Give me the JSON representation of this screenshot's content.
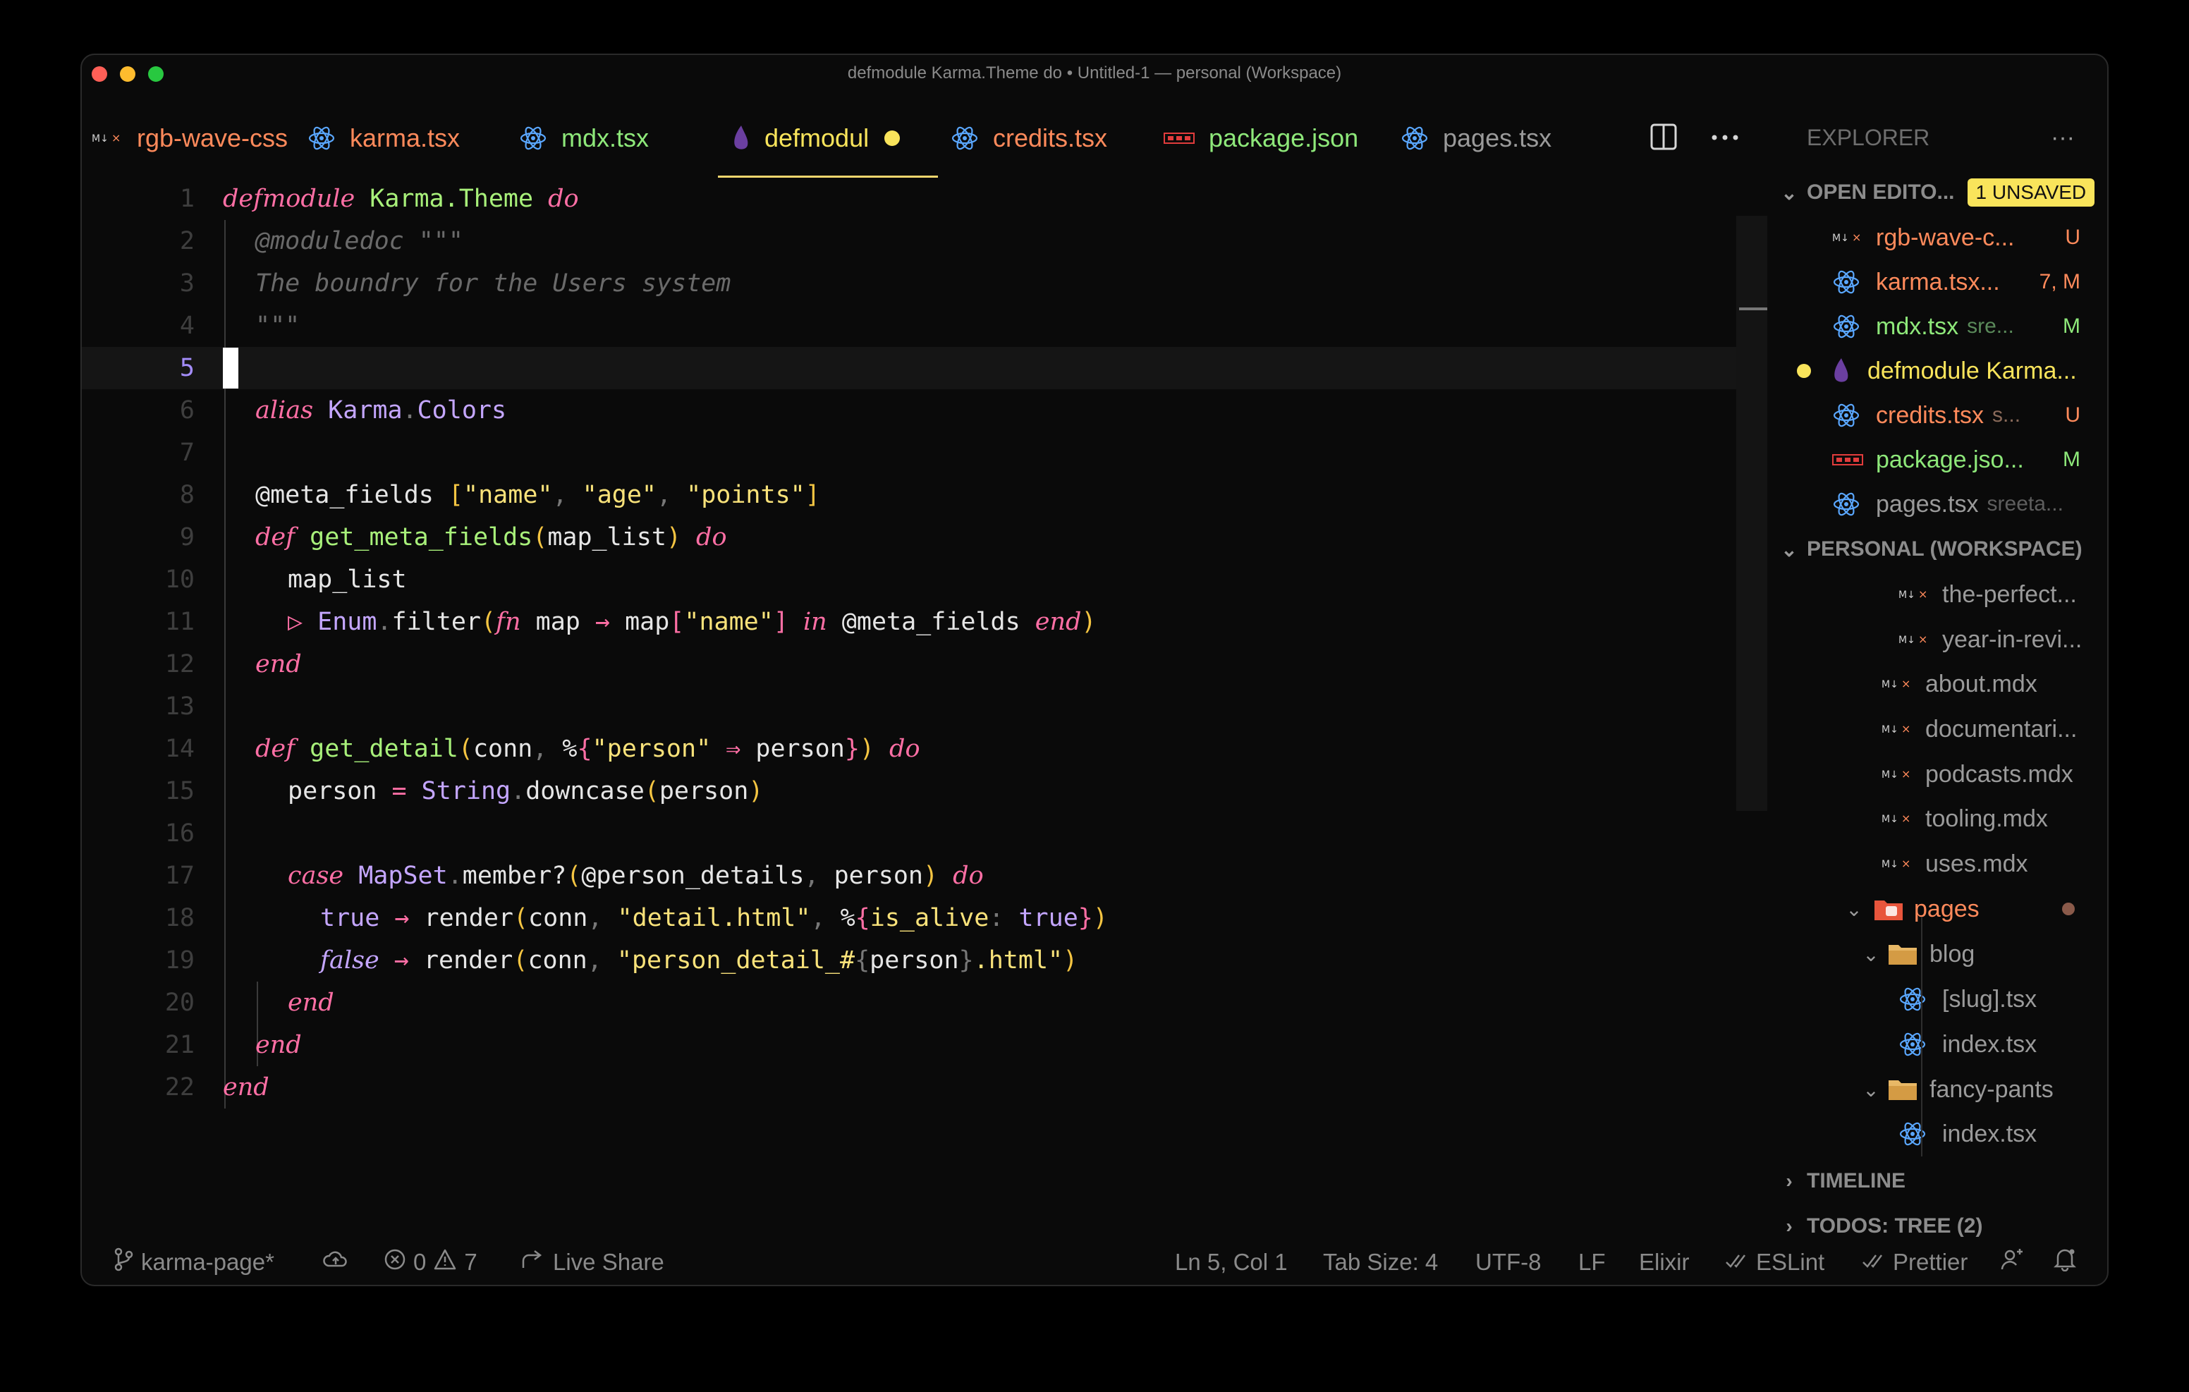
{
  "window": {
    "title": "defmodule Karma.Theme do • Untitled-1 — personal (Workspace)"
  },
  "tabs": [
    {
      "label": "rgb-wave-css",
      "icon": "markdown-icon",
      "color": "#ff8a5b"
    },
    {
      "label": "karma.tsx",
      "icon": "react-icon",
      "color": "#ff8a5b"
    },
    {
      "label": "mdx.tsx",
      "icon": "react-icon",
      "color": "#8ee87a"
    },
    {
      "label": "defmodul",
      "icon": "elixir-icon",
      "color": "#f9e45b",
      "active": true,
      "modified": true
    },
    {
      "label": "credits.tsx",
      "icon": "react-icon",
      "color": "#ff8a5b"
    },
    {
      "label": "package.json",
      "icon": "npm-icon",
      "color": "#8ee87a"
    },
    {
      "label": "pages.tsx",
      "icon": "react-icon",
      "color": "#9a9a9a"
    }
  ],
  "editor": {
    "line_numbers": [
      "1",
      "2",
      "3",
      "4",
      "5",
      "6",
      "7",
      "8",
      "9",
      "10",
      "11",
      "12",
      "13",
      "14",
      "15",
      "16",
      "17",
      "18",
      "19",
      "20",
      "21",
      "22"
    ],
    "active_line": "5"
  },
  "code": {
    "l1": [
      "defmodule",
      "Karma.Theme",
      "do"
    ],
    "l2": [
      "@moduledoc \"\"\""
    ],
    "l3": [
      "The boundry for the Users system"
    ],
    "l4": [
      "\"\"\""
    ],
    "l6": [
      "alias",
      "Karma",
      ".",
      "Colors"
    ],
    "l8": [
      "@meta_fields",
      "[",
      "\"name\"",
      ", ",
      "\"age\"",
      ", ",
      "\"points\"",
      "]"
    ],
    "l9": [
      "def",
      "get_meta_fields",
      "(",
      "map_list",
      ")",
      "do"
    ],
    "l10": [
      "map_list"
    ],
    "l11": [
      "▷",
      "Enum",
      ".",
      "filter",
      "(",
      "fn",
      "map",
      "→",
      "map",
      "[",
      "\"name\"",
      "]",
      "in",
      "@meta_fields",
      "end",
      ")"
    ],
    "l12": [
      "end"
    ],
    "l14": [
      "def",
      "get_detail",
      "(",
      "conn",
      ", ",
      "%",
      "{",
      "\"person\"",
      "⇒",
      "person",
      "}",
      ")",
      "do"
    ],
    "l15": [
      "person",
      "=",
      "String",
      ".",
      "downcase",
      "(",
      "person",
      ")"
    ],
    "l17": [
      "case",
      "MapSet",
      ".",
      "member?",
      "(",
      "@person_details",
      ", ",
      "person",
      ")",
      "do"
    ],
    "l18": [
      "true",
      "→",
      "render",
      "(",
      "conn",
      ", ",
      "\"detail.html\"",
      ", ",
      "%",
      "{",
      "is_alive",
      ":",
      "true",
      "}",
      ")"
    ],
    "l19": [
      "false",
      "→",
      "render",
      "(",
      "conn",
      ", ",
      "\"person_detail_#",
      "{",
      "person",
      "}",
      ".html\"",
      ")"
    ],
    "l20": [
      "end"
    ],
    "l21": [
      "end"
    ],
    "l22": [
      "end"
    ]
  },
  "sidebar": {
    "explorer_title": "EXPLORER",
    "more_label": "···",
    "open_editors": {
      "title": "OPEN EDITO...",
      "badge": "1 UNSAVED",
      "items": [
        {
          "name": "rgb-wave-c...",
          "desc": "",
          "status": "U",
          "color": "#ff8a5b",
          "icon": "markdown-icon"
        },
        {
          "name": "karma.tsx...",
          "desc": "",
          "status": "7, M",
          "color": "#ff8a5b",
          "icon": "react-icon"
        },
        {
          "name": "mdx.tsx",
          "desc": "sre...",
          "status": "M",
          "color": "#8ee87a",
          "icon": "react-icon"
        },
        {
          "name": "defmodule Karma...",
          "desc": "",
          "status": "",
          "color": "#f9e45b",
          "icon": "elixir-icon"
        },
        {
          "name": "credits.tsx",
          "desc": "s...",
          "status": "U",
          "color": "#ff8a5b",
          "icon": "react-icon"
        },
        {
          "name": "package.jso...",
          "desc": "",
          "status": "M",
          "color": "#8ee87a",
          "icon": "npm-icon"
        },
        {
          "name": "pages.tsx",
          "desc": "sreeta...",
          "status": "",
          "color": "#9a9a9a",
          "icon": "react-icon"
        }
      ]
    },
    "workspace": {
      "title": "PERSONAL (WORKSPACE)",
      "items": [
        {
          "name": "the-perfect...",
          "icon": "markdown-icon"
        },
        {
          "name": "year-in-revi...",
          "icon": "markdown-icon"
        },
        {
          "name": "about.mdx",
          "icon": "markdown-icon"
        },
        {
          "name": "documentari...",
          "icon": "markdown-icon"
        },
        {
          "name": "podcasts.mdx",
          "icon": "markdown-icon"
        },
        {
          "name": "tooling.mdx",
          "icon": "markdown-icon"
        },
        {
          "name": "uses.mdx",
          "icon": "markdown-icon"
        },
        {
          "name": "pages",
          "icon": "folder-pages-icon"
        },
        {
          "name": "blog",
          "icon": "folder-icon"
        },
        {
          "name": "[slug].tsx",
          "icon": "react-icon"
        },
        {
          "name": "index.tsx",
          "icon": "react-icon"
        },
        {
          "name": "fancy-pants",
          "icon": "folder-icon"
        },
        {
          "name": "index.tsx",
          "icon": "react-icon"
        }
      ]
    },
    "timeline": "TIMELINE",
    "todos": "TODOS: TREE (2)"
  },
  "statusbar": {
    "branch": "karma-page*",
    "errors": "0",
    "warnings": "7",
    "live_share": "Live Share",
    "position": "Ln 5, Col 1",
    "tab_size": "Tab Size: 4",
    "encoding": "UTF-8",
    "eol": "LF",
    "language": "Elixir",
    "eslint": "ESLint",
    "prettier": "Prettier"
  }
}
